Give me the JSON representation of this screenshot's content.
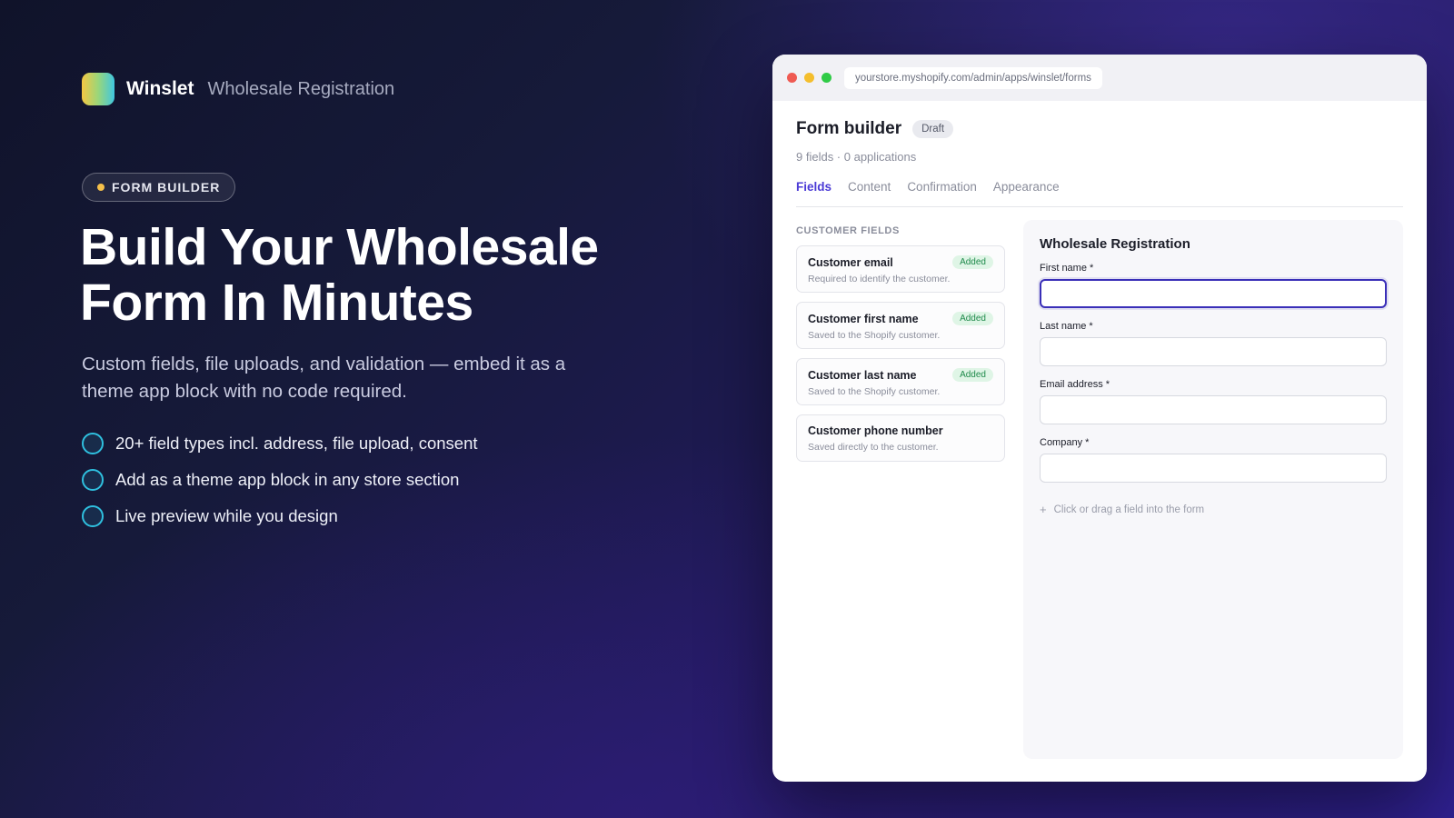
{
  "brand": {
    "name": "Winslet",
    "subtitle": "Wholesale Registration"
  },
  "hero": {
    "pill": "FORM BUILDER",
    "headline_line1": "Build Your Wholesale",
    "headline_line2": "Form In Minutes",
    "subtitle": "Custom fields, file uploads, and validation — embed it as a theme app block with no code required.",
    "features": [
      "20+ field types incl. address, file upload, consent",
      "Add as a theme app block in any store section",
      "Live preview while you design"
    ]
  },
  "browser": {
    "url": "yourstore.myshopify.com/admin/apps/winslet/forms"
  },
  "app": {
    "title": "Form builder",
    "status": "Draft",
    "meta": "9 fields · 0 applications",
    "tabs": [
      "Fields",
      "Content",
      "Confirmation",
      "Appearance"
    ],
    "active_tab": "Fields",
    "section_label": "CUSTOMER FIELDS",
    "fields": [
      {
        "name": "Customer email",
        "desc": "Required to identify the customer.",
        "badge": "Added"
      },
      {
        "name": "Customer first name",
        "desc": "Saved to the Shopify customer.",
        "badge": "Added"
      },
      {
        "name": "Customer last name",
        "desc": "Saved to the Shopify customer.",
        "badge": "Added"
      },
      {
        "name": "Customer phone number",
        "desc": "Saved directly to the customer.",
        "badge": ""
      }
    ],
    "preview": {
      "title": "Wholesale Registration",
      "fields": [
        {
          "label": "First name *",
          "value": ""
        },
        {
          "label": "Last name *",
          "value": ""
        },
        {
          "label": "Email address *",
          "value": ""
        },
        {
          "label": "Company *",
          "value": ""
        }
      ],
      "add_hint": "Click or drag a field into the form"
    }
  },
  "colors": {
    "accent": "#4b3bd6",
    "feature_ring": "#2fc0df",
    "pill_dot": "#f5c04a",
    "badge_green": "#1f8a4b"
  }
}
